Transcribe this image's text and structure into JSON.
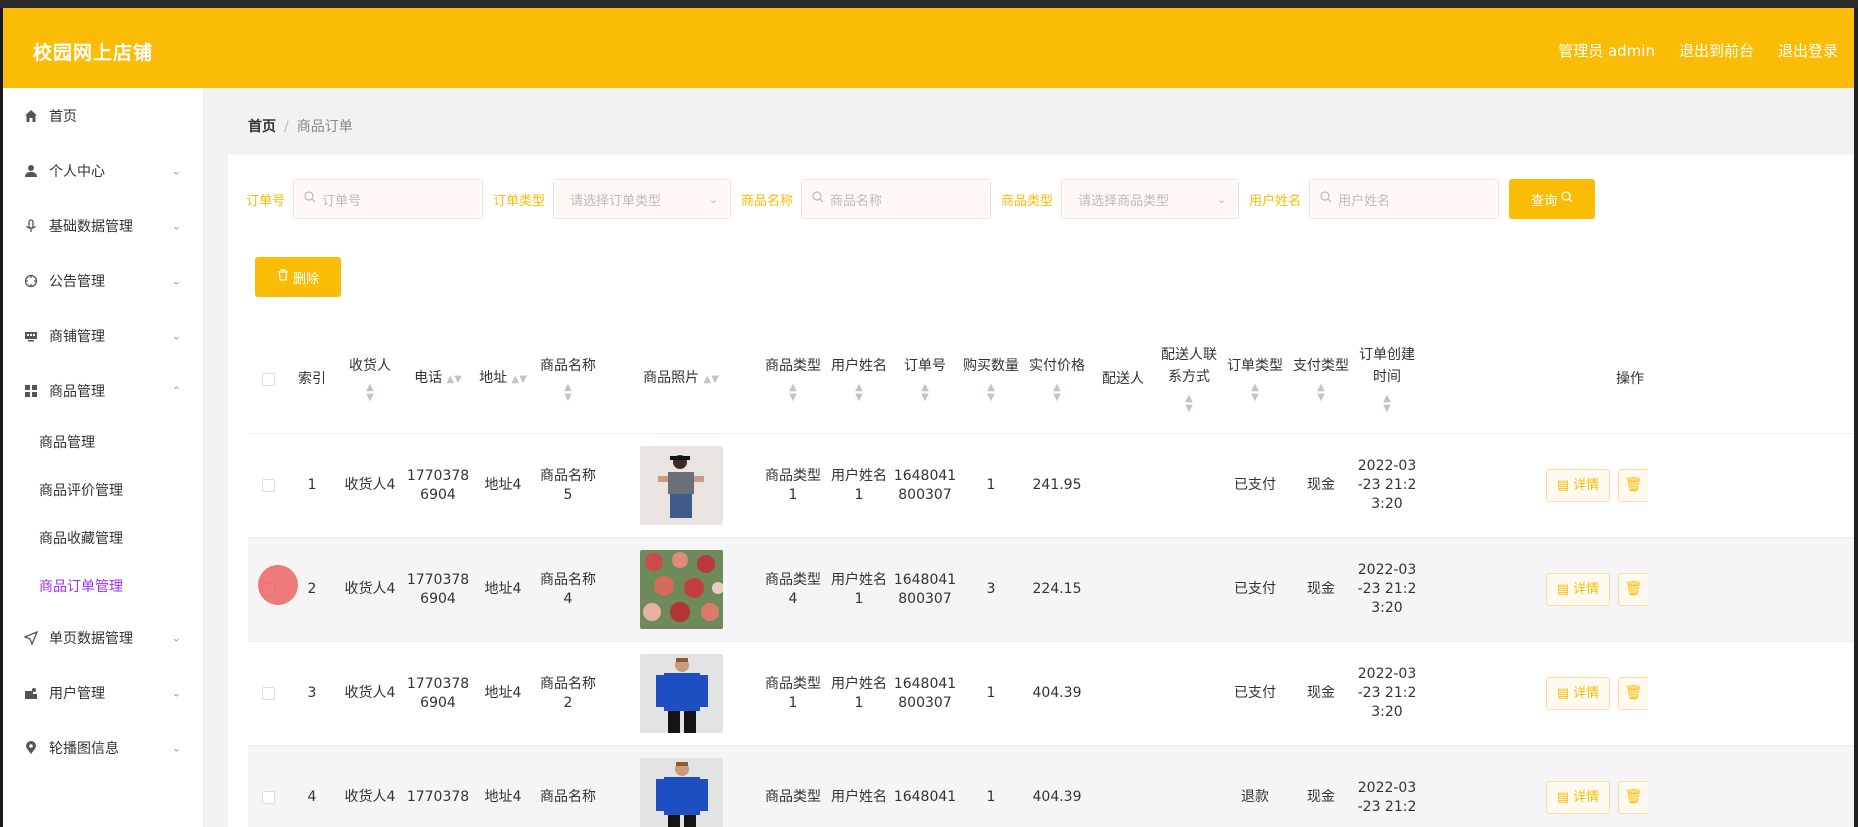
{
  "header": {
    "brand": "校园网上店铺",
    "admin_label": "管理员 admin",
    "back_to_front": "退出到前台",
    "logout": "退出登录"
  },
  "sidebar": {
    "items": [
      {
        "label": "首页",
        "icon": "home-icon"
      },
      {
        "label": "个人中心",
        "icon": "user-icon"
      },
      {
        "label": "基础数据管理",
        "icon": "mic-icon"
      },
      {
        "label": "公告管理",
        "icon": "compass-icon"
      },
      {
        "label": "商铺管理",
        "icon": "monitor-icon"
      },
      {
        "label": "商品管理",
        "icon": "grid-icon"
      }
    ],
    "sub_items": [
      "商品管理",
      "商品评价管理",
      "商品收藏管理",
      "商品订单管理"
    ],
    "items_after": [
      {
        "label": "单页数据管理",
        "icon": "send-icon"
      },
      {
        "label": "用户管理",
        "icon": "team-icon"
      },
      {
        "label": "轮播图信息",
        "icon": "pin-icon"
      }
    ]
  },
  "breadcrumb": {
    "home": "首页",
    "current": "商品订单"
  },
  "filters": {
    "order_no_label": "订单号",
    "order_no_placeholder": "订单号",
    "order_type_label": "订单类型",
    "order_type_placeholder": "请选择订单类型",
    "product_name_label": "商品名称",
    "product_name_placeholder": "商品名称",
    "product_type_label": "商品类型",
    "product_type_placeholder": "请选择商品类型",
    "user_name_label": "用户姓名",
    "user_name_placeholder": "用户姓名",
    "search_button": "查询",
    "delete_button": "删除"
  },
  "table": {
    "headers": {
      "index": "索引",
      "receiver": "收货人",
      "phone": "电话",
      "address": "地址",
      "product_name": "商品名称",
      "product_image": "商品照片",
      "product_type": "商品类型",
      "user_name": "用户姓名",
      "order_no": "订单号",
      "quantity": "购买数量",
      "price": "实付价格",
      "courier": "配送人",
      "courier_phone_1": "配送人联",
      "courier_phone_2": "系方式",
      "order_type": "订单类型",
      "pay_type": "支付类型",
      "created_1": "订单创建",
      "created_2": "时间",
      "actions": "操作"
    },
    "detail_label": "详情",
    "rows": [
      {
        "index": "1",
        "receiver": "收货人4",
        "phone_1": "1770378",
        "phone_2": "6904",
        "address": "地址4",
        "pname_1": "商品名称",
        "pname_2": "5",
        "ptype_1": "商品类型",
        "ptype_2": "1",
        "uname_1": "用户姓名",
        "uname_2": "1",
        "order_1": "1648041",
        "order_2": "800307",
        "qty": "1",
        "price": "241.95",
        "courier": "",
        "courier_phone": "",
        "order_type": "已支付",
        "pay_type": "现金",
        "time_1": "2022-03",
        "time_2": "-23 21:2",
        "time_3": "3:20",
        "image": "woman-dress"
      },
      {
        "index": "2",
        "receiver": "收货人4",
        "phone_1": "1770378",
        "phone_2": "6904",
        "address": "地址4",
        "pname_1": "商品名称",
        "pname_2": "4",
        "ptype_1": "商品类型",
        "ptype_2": "4",
        "uname_1": "用户姓名",
        "uname_2": "1",
        "order_1": "1648041",
        "order_2": "800307",
        "qty": "3",
        "price": "224.15",
        "courier": "",
        "courier_phone": "",
        "order_type": "已支付",
        "pay_type": "现金",
        "time_1": "2022-03",
        "time_2": "-23 21:2",
        "time_3": "3:20",
        "image": "roses"
      },
      {
        "index": "3",
        "receiver": "收货人4",
        "phone_1": "1770378",
        "phone_2": "6904",
        "address": "地址4",
        "pname_1": "商品名称",
        "pname_2": "2",
        "ptype_1": "商品类型",
        "ptype_2": "1",
        "uname_1": "用户姓名",
        "uname_2": "1",
        "order_1": "1648041",
        "order_2": "800307",
        "qty": "1",
        "price": "404.39",
        "courier": "",
        "courier_phone": "",
        "order_type": "已支付",
        "pay_type": "现金",
        "time_1": "2022-03",
        "time_2": "-23 21:2",
        "time_3": "3:20",
        "image": "man-sweater"
      },
      {
        "index": "4",
        "receiver": "收货人4",
        "phone_1": "1770378",
        "phone_2": "",
        "address": "地址4",
        "pname_1": "商品名称",
        "pname_2": "",
        "ptype_1": "商品类型",
        "ptype_2": "",
        "uname_1": "用户姓名",
        "uname_2": "",
        "order_1": "1648041",
        "order_2": "",
        "qty": "1",
        "price": "404.39",
        "courier": "",
        "courier_phone": "",
        "order_type": "退款",
        "pay_type": "现金",
        "time_1": "2022-03",
        "time_2": "-23 21:2",
        "time_3": "",
        "image": "man-sweater"
      }
    ]
  },
  "colors": {
    "accent": "#fbbc05",
    "active_sub": "#9b30ff"
  }
}
